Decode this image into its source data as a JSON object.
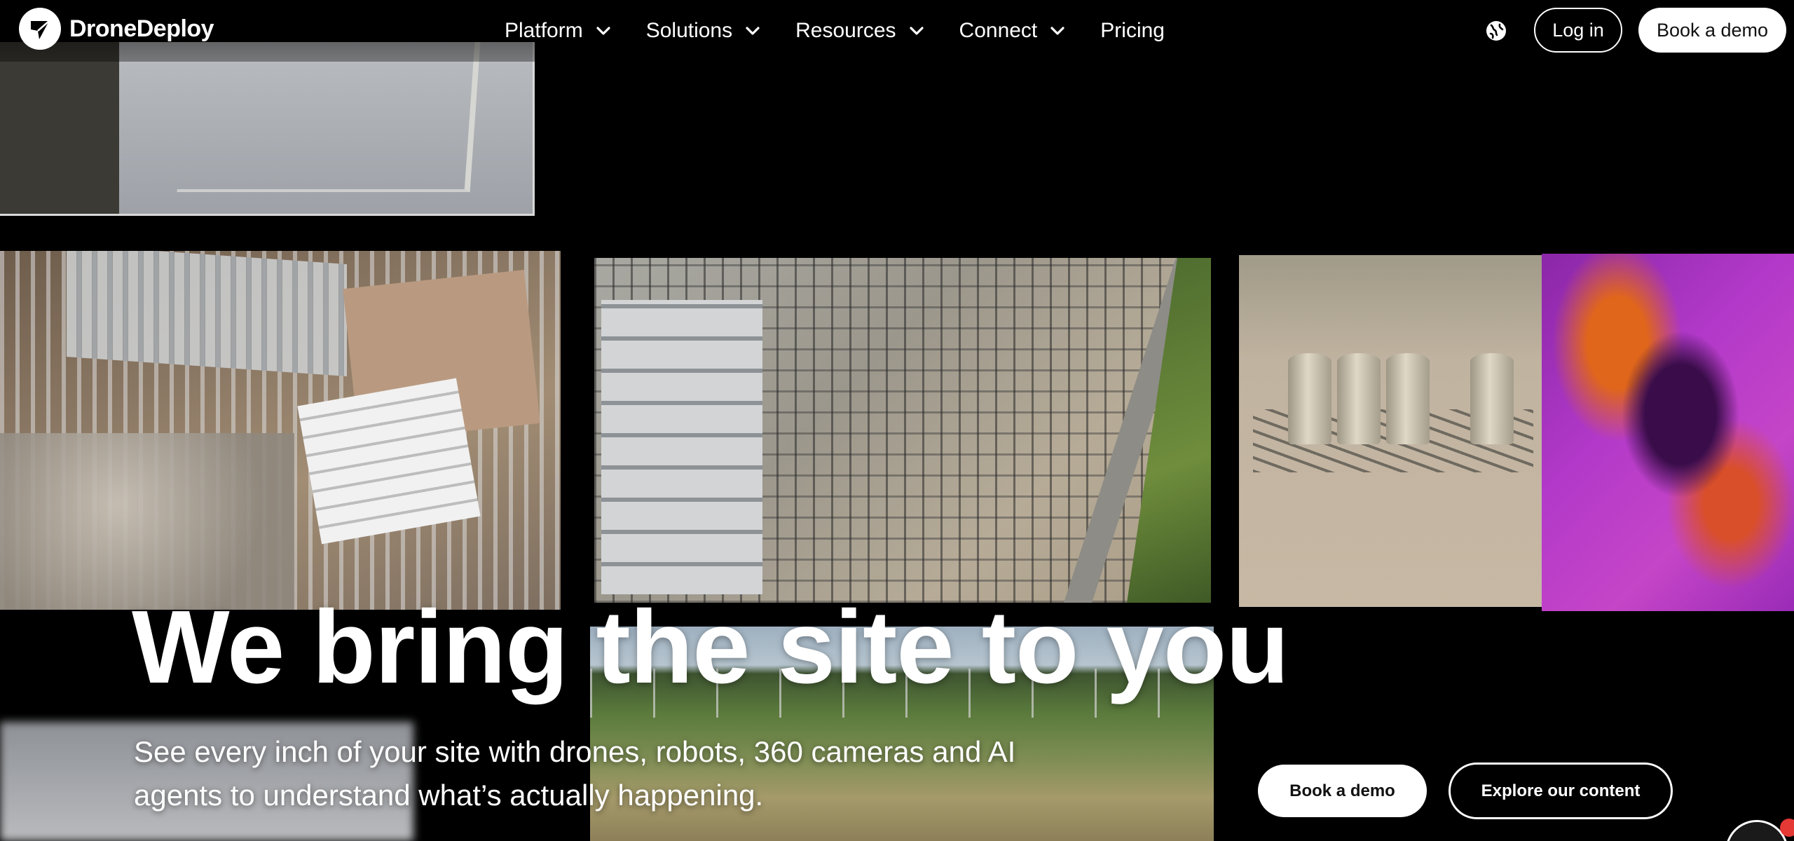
{
  "brand": {
    "name": "DroneDeploy",
    "logo_icon": "dronedeploy-logo-icon"
  },
  "nav": {
    "items": [
      {
        "label": "Platform",
        "has_dropdown": true
      },
      {
        "label": "Solutions",
        "has_dropdown": true
      },
      {
        "label": "Resources",
        "has_dropdown": true
      },
      {
        "label": "Connect",
        "has_dropdown": true
      },
      {
        "label": "Pricing",
        "has_dropdown": false
      }
    ],
    "language_icon": "globe-icon",
    "login_label": "Log in",
    "demo_label": "Book a demo"
  },
  "hero": {
    "title": "We bring the site to you",
    "subtitle_line1": "See every inch of your site with drones, robots, 360 cameras and AI",
    "subtitle_line2": "agents to understand what’s actually happening.",
    "cta_primary": "Book a demo",
    "cta_secondary": "Explore our content"
  },
  "colors": {
    "background": "#000000",
    "text": "#ffffff",
    "button_fill": "#ffffff",
    "button_text": "#111111",
    "thermal_purple": "#b239c9",
    "thermal_orange": "#e0661b",
    "chat_badge": "#e53935"
  }
}
